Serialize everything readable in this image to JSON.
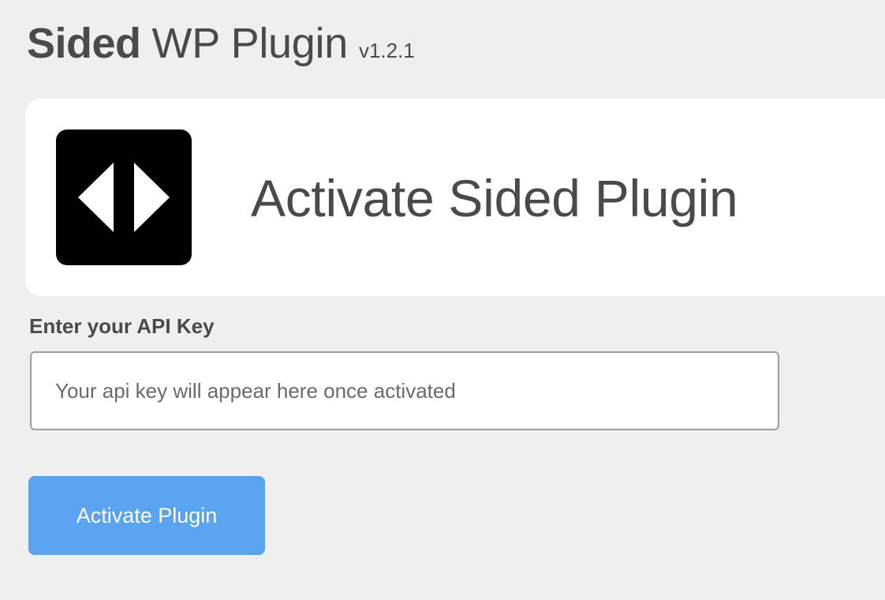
{
  "header": {
    "title_bold": "Sided",
    "title_light": "WP Plugin",
    "version": "v1.2.1"
  },
  "card": {
    "logo_icon": "sided-logo-icon",
    "heading": "Activate Sided Plugin"
  },
  "form": {
    "api_key_label": "Enter your API Key",
    "api_key_value": "",
    "api_key_placeholder": "Your api key will appear here once activated",
    "activate_label": "Activate Plugin"
  },
  "colors": {
    "background": "#efefef",
    "card": "#ffffff",
    "text": "#4a4a4a",
    "button": "#5aa3f0",
    "logo": "#000000"
  }
}
